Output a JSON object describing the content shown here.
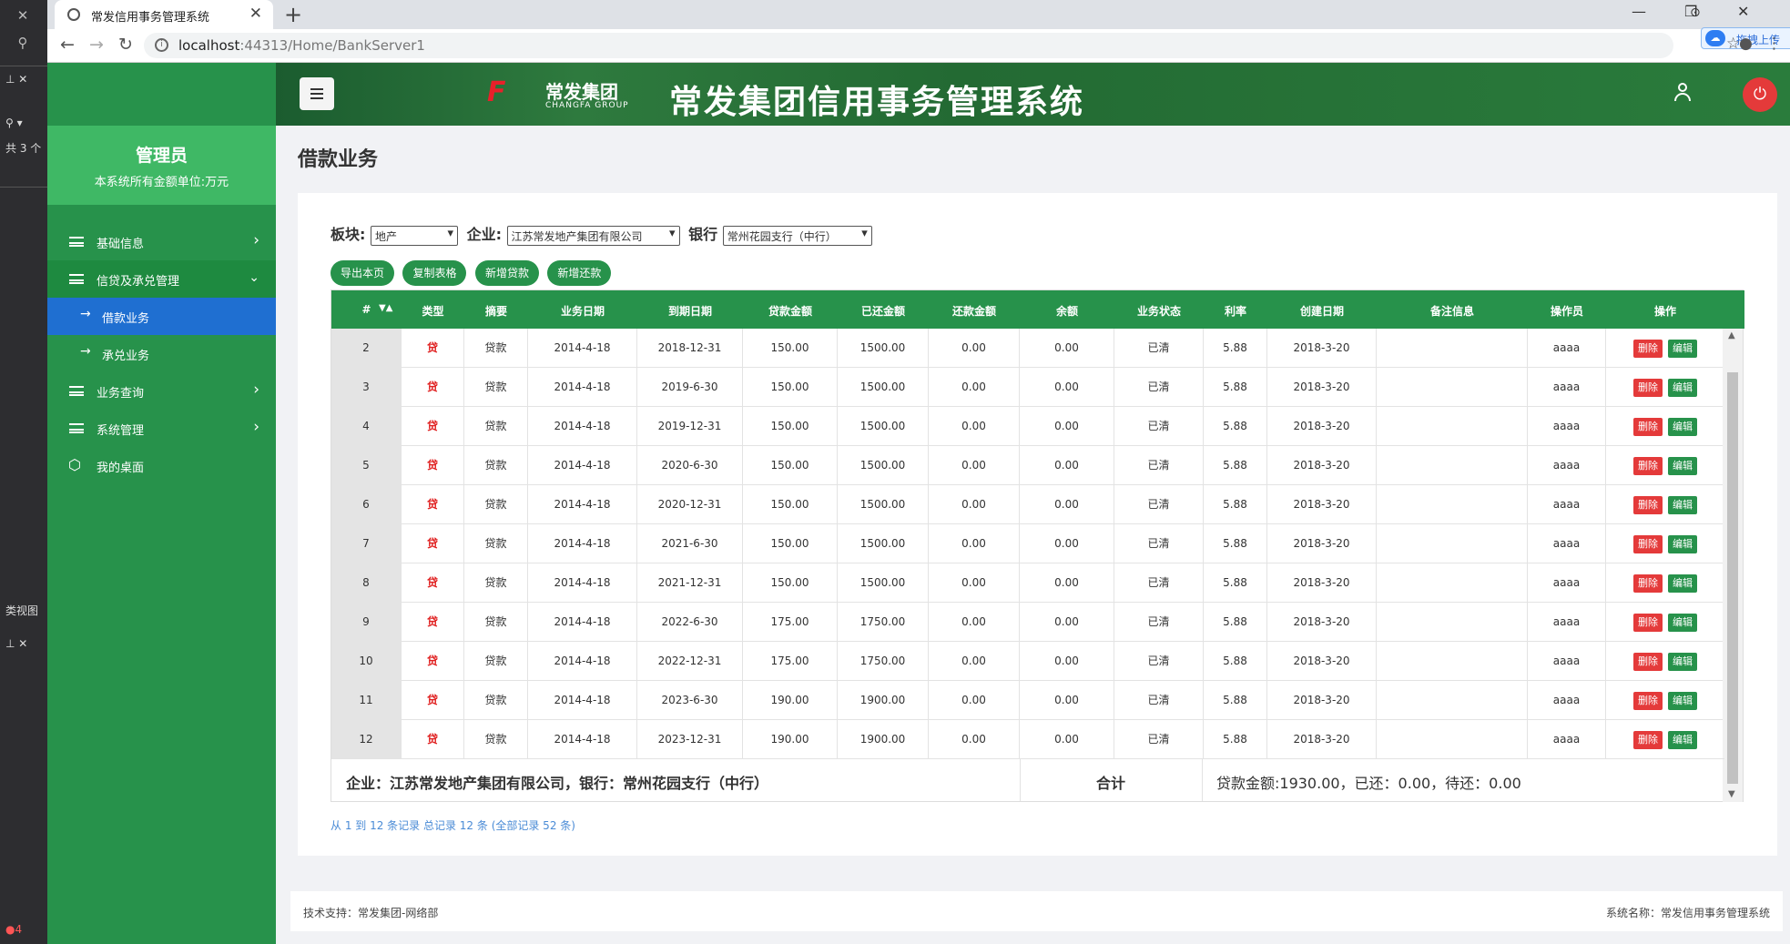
{
  "ide": {
    "share_count": "共 3 个",
    "class_view": "类视图"
  },
  "browser": {
    "tab_title": "常发信用事务管理系统",
    "url_host": "localhost",
    "url_rest": ":44313/Home/BankServer1",
    "upload_chip": "拖拽上传"
  },
  "sidebar": {
    "admin_name": "管理员",
    "unit_note": "本系统所有金额单位:万元",
    "items": [
      {
        "label": "基础信息"
      },
      {
        "label": "信贷及承兑管理"
      },
      {
        "label": "借款业务"
      },
      {
        "label": "承兑业务"
      },
      {
        "label": "业务查询"
      },
      {
        "label": "系统管理"
      },
      {
        "label": "我的桌面"
      }
    ]
  },
  "banner": {
    "logo_cn": "常发集团",
    "logo_en": "CHANGFA GROUP",
    "system_title": "常发集团信用事务管理系统"
  },
  "main": {
    "page_title": "借款业务",
    "filters": {
      "sector_label": "板块:",
      "sector_value": "地产",
      "company_label": "企业:",
      "company_value": "江苏常发地产集团有限公司",
      "bank_label": "银行",
      "bank_value": "常州花园支行（中行）"
    },
    "buttons": {
      "export": "导出本页",
      "copy": "复制表格",
      "add_loan": "新增贷款",
      "add_repay": "新增还款"
    },
    "table": {
      "headers": [
        "#",
        "类型",
        "摘要",
        "业务日期",
        "到期日期",
        "贷款金额",
        "已还金额",
        "还款金额",
        "余额",
        "业务状态",
        "利率",
        "创建日期",
        "备注信息",
        "操作员",
        "操作"
      ],
      "sort_glyph": "▼▲",
      "delete_label": "删除",
      "edit_label": "编辑",
      "rows": [
        {
          "n": "2",
          "type": "贷",
          "summary": "贷款",
          "biz_date": "2014-4-18",
          "due": "2018-12-31",
          "loan": "150.00",
          "repaid": "1500.00",
          "repay": "0.00",
          "balance": "0.00",
          "status": "已清",
          "rate": "5.88",
          "created": "2018-3-20",
          "note": "",
          "op": "aaaa"
        },
        {
          "n": "3",
          "type": "贷",
          "summary": "贷款",
          "biz_date": "2014-4-18",
          "due": "2019-6-30",
          "loan": "150.00",
          "repaid": "1500.00",
          "repay": "0.00",
          "balance": "0.00",
          "status": "已清",
          "rate": "5.88",
          "created": "2018-3-20",
          "note": "",
          "op": "aaaa"
        },
        {
          "n": "4",
          "type": "贷",
          "summary": "贷款",
          "biz_date": "2014-4-18",
          "due": "2019-12-31",
          "loan": "150.00",
          "repaid": "1500.00",
          "repay": "0.00",
          "balance": "0.00",
          "status": "已清",
          "rate": "5.88",
          "created": "2018-3-20",
          "note": "",
          "op": "aaaa"
        },
        {
          "n": "5",
          "type": "贷",
          "summary": "贷款",
          "biz_date": "2014-4-18",
          "due": "2020-6-30",
          "loan": "150.00",
          "repaid": "1500.00",
          "repay": "0.00",
          "balance": "0.00",
          "status": "已清",
          "rate": "5.88",
          "created": "2018-3-20",
          "note": "",
          "op": "aaaa"
        },
        {
          "n": "6",
          "type": "贷",
          "summary": "贷款",
          "biz_date": "2014-4-18",
          "due": "2020-12-31",
          "loan": "150.00",
          "repaid": "1500.00",
          "repay": "0.00",
          "balance": "0.00",
          "status": "已清",
          "rate": "5.88",
          "created": "2018-3-20",
          "note": "",
          "op": "aaaa"
        },
        {
          "n": "7",
          "type": "贷",
          "summary": "贷款",
          "biz_date": "2014-4-18",
          "due": "2021-6-30",
          "loan": "150.00",
          "repaid": "1500.00",
          "repay": "0.00",
          "balance": "0.00",
          "status": "已清",
          "rate": "5.88",
          "created": "2018-3-20",
          "note": "",
          "op": "aaaa"
        },
        {
          "n": "8",
          "type": "贷",
          "summary": "贷款",
          "biz_date": "2014-4-18",
          "due": "2021-12-31",
          "loan": "150.00",
          "repaid": "1500.00",
          "repay": "0.00",
          "balance": "0.00",
          "status": "已清",
          "rate": "5.88",
          "created": "2018-3-20",
          "note": "",
          "op": "aaaa"
        },
        {
          "n": "9",
          "type": "贷",
          "summary": "贷款",
          "biz_date": "2014-4-18",
          "due": "2022-6-30",
          "loan": "175.00",
          "repaid": "1750.00",
          "repay": "0.00",
          "balance": "0.00",
          "status": "已清",
          "rate": "5.88",
          "created": "2018-3-20",
          "note": "",
          "op": "aaaa"
        },
        {
          "n": "10",
          "type": "贷",
          "summary": "贷款",
          "biz_date": "2014-4-18",
          "due": "2022-12-31",
          "loan": "175.00",
          "repaid": "1750.00",
          "repay": "0.00",
          "balance": "0.00",
          "status": "已清",
          "rate": "5.88",
          "created": "2018-3-20",
          "note": "",
          "op": "aaaa"
        },
        {
          "n": "11",
          "type": "贷",
          "summary": "贷款",
          "biz_date": "2014-4-18",
          "due": "2023-6-30",
          "loan": "190.00",
          "repaid": "1900.00",
          "repay": "0.00",
          "balance": "0.00",
          "status": "已清",
          "rate": "5.88",
          "created": "2018-3-20",
          "note": "",
          "op": "aaaa"
        },
        {
          "n": "12",
          "type": "贷",
          "summary": "贷款",
          "biz_date": "2014-4-18",
          "due": "2023-12-31",
          "loan": "190.00",
          "repaid": "1900.00",
          "repay": "0.00",
          "balance": "0.00",
          "status": "已清",
          "rate": "5.88",
          "created": "2018-3-20",
          "note": "",
          "op": "aaaa"
        }
      ],
      "footer_entity": "企业：江苏常发地产集团有限公司，银行：常州花园支行（中行）",
      "footer_total_label": "合计",
      "footer_sums": "贷款金额:1930.00，已还：0.00，待还：0.00"
    },
    "pager_text": "从 1 到 12 条记录 总记录 12 条 (全部记录 52 条)"
  },
  "footer": {
    "left": "技术支持：常发集团-网络部",
    "right": "系统名称：常发信用事务管理系统"
  },
  "colors": {
    "brand_green": "#27924b",
    "light_green": "#3fb865",
    "active_blue": "#1f6fd1",
    "danger": "#e43a3a"
  }
}
